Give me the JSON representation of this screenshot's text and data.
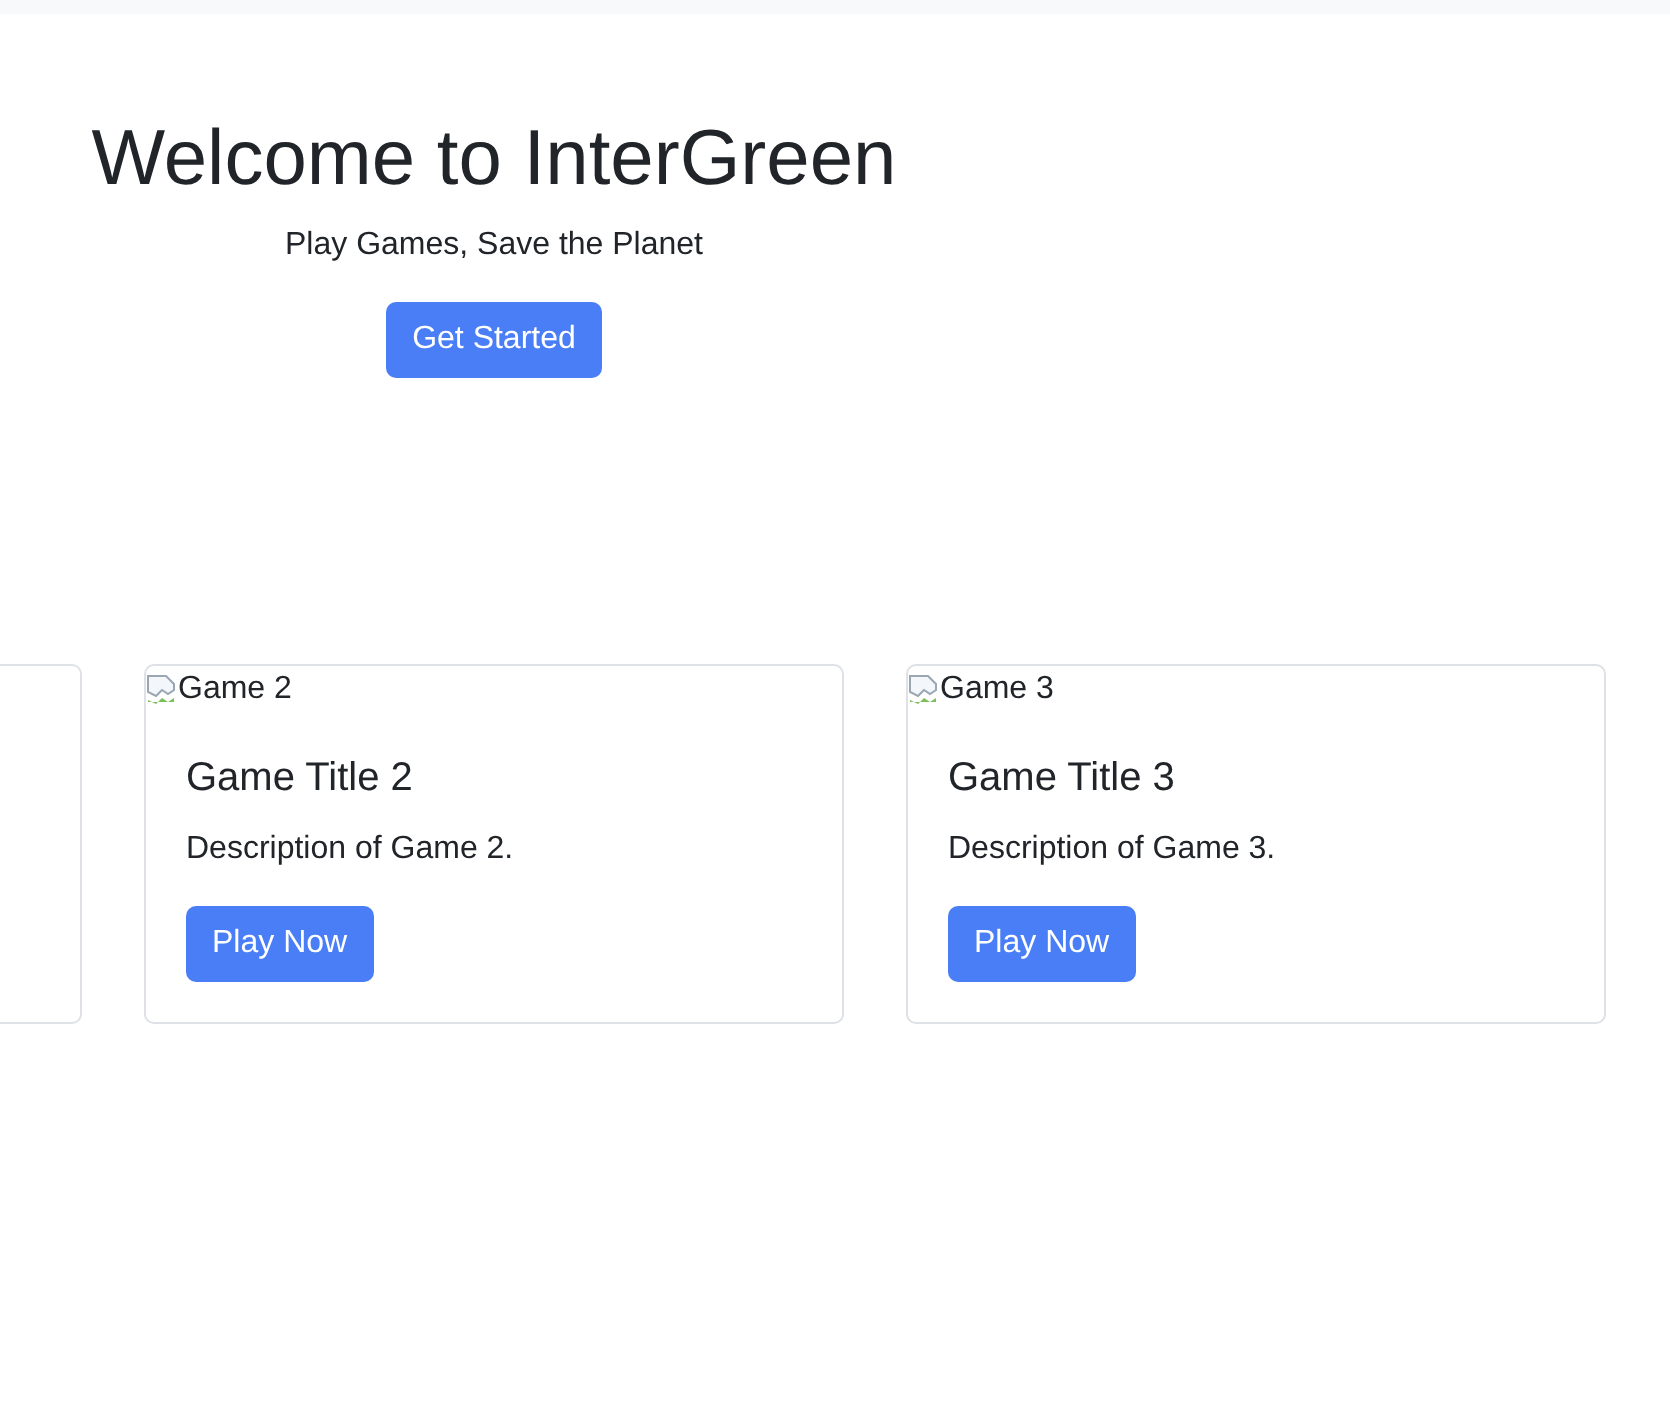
{
  "hero": {
    "title": "Welcome to InterGreen",
    "subtitle": "Play Games, Save the Planet",
    "button": "Get Started"
  },
  "cards": [
    {
      "kind": "cut_off"
    },
    {
      "kind": "game",
      "image_alt": "Game 2",
      "title": "Game Title 2",
      "description": "Description of Game 2.",
      "button": "Play Now"
    },
    {
      "kind": "game",
      "image_alt": "Game 3",
      "title": "Game Title 3",
      "description": "Description of Game 3.",
      "button": "Play Now"
    }
  ]
}
